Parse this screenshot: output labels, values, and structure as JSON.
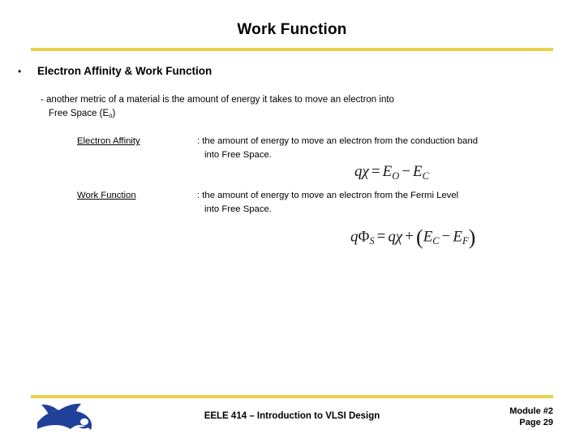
{
  "slide": {
    "title": "Work Function",
    "accent_color": "#E8D14A",
    "logo_color": "#21409A"
  },
  "body": {
    "bullet_marker": "•",
    "heading": "Electron Affinity & Work Function",
    "sub_dash": "- another metric of a material is the amount of energy it takes to move an electron into",
    "sub_cont_prefix": "Free Space (E",
    "sub_cont_subscript": "o",
    "sub_cont_suffix": ")",
    "definitions": [
      {
        "term": "Electron Affinity",
        "line1": ": the amount of energy to move an electron from the conduction band",
        "line2": "into Free Space."
      },
      {
        "term": "Work Function",
        "line1": ": the amount of energy to move an electron from the Fermi Level",
        "line2": "into Free Space."
      }
    ]
  },
  "equations": {
    "electron_affinity": {
      "q": "q",
      "chi": "χ",
      "equals": "=",
      "E1": "E",
      "E1_sub": "O",
      "minus": "−",
      "E2": "E",
      "E2_sub": "C",
      "plain": "qχ = E_O − E_C"
    },
    "work_function": {
      "q": "q",
      "phi": "Φ",
      "phi_sub": "S",
      "equals": "=",
      "q2": "q",
      "chi": "χ",
      "plus": "+",
      "open_paren": "(",
      "E1": "E",
      "E1_sub": "C",
      "minus": "−",
      "E2": "E",
      "E2_sub": "F",
      "close_paren": ")",
      "plain": "qΦ_S = qχ + (E_C − E_F)"
    }
  },
  "footer": {
    "course": "EELE 414 – Introduction to VLSI Design",
    "module": "Module #2",
    "page": "Page 29"
  }
}
